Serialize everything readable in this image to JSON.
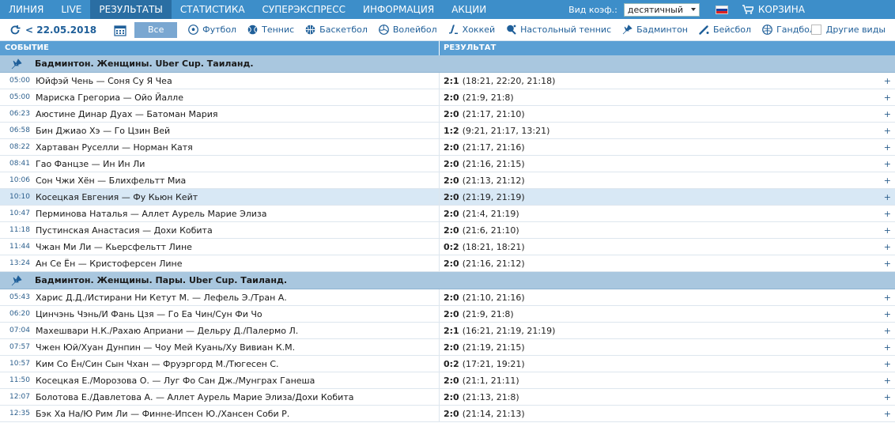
{
  "nav": {
    "items": [
      {
        "label": "ЛИНИЯ",
        "active": false
      },
      {
        "label": "LIVE",
        "active": false
      },
      {
        "label": "РЕЗУЛЬТАТЫ",
        "active": true
      },
      {
        "label": "СТАТИСТИКА",
        "active": false
      },
      {
        "label": "СУПЕРЭКСПРЕСС",
        "active": false
      },
      {
        "label": "ИНФОРМАЦИЯ",
        "active": false
      },
      {
        "label": "АКЦИИ",
        "active": false
      }
    ],
    "coef_label": "Вид коэф.:",
    "coef_value": "десятичный",
    "cart_label": "КОРЗИНА"
  },
  "filter": {
    "date": "< 22.05.2018",
    "all_label": "Все",
    "sports": [
      {
        "label": "Футбол",
        "icon": "football-icon"
      },
      {
        "label": "Теннис",
        "icon": "tennis-icon"
      },
      {
        "label": "Баскетбол",
        "icon": "basketball-icon"
      },
      {
        "label": "Волейбол",
        "icon": "volleyball-icon"
      },
      {
        "label": "Хоккей",
        "icon": "hockey-icon"
      },
      {
        "label": "Настольный теннис",
        "icon": "table-tennis-icon"
      },
      {
        "label": "Бадминтон",
        "icon": "badminton-icon"
      },
      {
        "label": "Бейсбол",
        "icon": "baseball-icon"
      },
      {
        "label": "Гандбол",
        "icon": "handball-icon"
      }
    ],
    "others_label": "Другие виды"
  },
  "table": {
    "col_event": "СОБЫТИЕ",
    "col_result": "РЕЗУЛЬТАТ"
  },
  "groups": [
    {
      "title": "Бадминтон. Женщины. Uber Cup. Таиланд.",
      "rows": [
        {
          "time": "05:00",
          "event": "Юйфэй Чень — Соня Су Я Чеа",
          "score": "2:1",
          "detail": "(18:21, 22:20, 21:18)"
        },
        {
          "time": "05:00",
          "event": "Мариска Грегориа — Ойо Йалле",
          "score": "2:0",
          "detail": "(21:9, 21:8)"
        },
        {
          "time": "06:23",
          "event": "Аюстине Динар Дуах — Батоман Мария",
          "score": "2:0",
          "detail": "(21:17, 21:10)"
        },
        {
          "time": "06:58",
          "event": "Бин Джиао Хэ — Го Цзин Вей",
          "score": "1:2",
          "detail": "(9:21, 21:17, 13:21)"
        },
        {
          "time": "08:22",
          "event": "Хартаван Руселли — Норман Катя",
          "score": "2:0",
          "detail": "(21:17, 21:16)"
        },
        {
          "time": "08:41",
          "event": "Гао Фанцзе — Ин Ин Ли",
          "score": "2:0",
          "detail": "(21:16, 21:15)"
        },
        {
          "time": "10:06",
          "event": "Сон Чжи Хён — Блихфельтт Миа",
          "score": "2:0",
          "detail": "(21:13, 21:12)"
        },
        {
          "time": "10:10",
          "event": "Косецкая Евгения — Фу Кьюн Кейт",
          "score": "2:0",
          "detail": "(21:19, 21:19)",
          "highlight": true
        },
        {
          "time": "10:47",
          "event": "Перминова Наталья — Аллет Аурель Марие Элиза",
          "score": "2:0",
          "detail": "(21:4, 21:19)"
        },
        {
          "time": "11:18",
          "event": "Пустинская Анастасия — Дохи Кобита",
          "score": "2:0",
          "detail": "(21:6, 21:10)"
        },
        {
          "time": "11:44",
          "event": "Чжан Ми Ли — Кьерсфельтт Лине",
          "score": "0:2",
          "detail": "(18:21, 18:21)"
        },
        {
          "time": "13:24",
          "event": "Ан Се Ён — Кристоферсен Лине",
          "score": "2:0",
          "detail": "(21:16, 21:12)"
        }
      ]
    },
    {
      "title": "Бадминтон. Женщины. Пары. Uber Cup. Таиланд.",
      "rows": [
        {
          "time": "05:43",
          "event": "Харис Д.Д./Истирани Ни Кетут М. — Лефель Э./Тран А.",
          "score": "2:0",
          "detail": "(21:10, 21:16)"
        },
        {
          "time": "06:20",
          "event": "Цинчэнь Чэнь/И Фань Цзя — Го Еа Чин/Сун Фи Чо",
          "score": "2:0",
          "detail": "(21:9, 21:8)"
        },
        {
          "time": "07:04",
          "event": "Махешвари Н.К./Рахаю Априани — Дельру Д./Палермо Л.",
          "score": "2:1",
          "detail": "(16:21, 21:19, 21:19)"
        },
        {
          "time": "07:57",
          "event": "Чжен Юй/Хуан Дунпин — Чоу Мей Куань/Ху Вивиан К.М.",
          "score": "2:0",
          "detail": "(21:19, 21:15)"
        },
        {
          "time": "10:57",
          "event": "Ким Со Ён/Син Сын Чхан — Фруэргорд М./Тюгесен С.",
          "score": "0:2",
          "detail": "(17:21, 19:21)"
        },
        {
          "time": "11:50",
          "event": "Косецкая Е./Морозова О. — Луг Фо Сан Дж./Мунграх Ганеша",
          "score": "2:0",
          "detail": "(21:1, 21:11)"
        },
        {
          "time": "12:07",
          "event": "Болотова Е./Давлетова А. — Аллет Аурель Марие Элиза/Дохи Кобита",
          "score": "2:0",
          "detail": "(21:13, 21:8)"
        },
        {
          "time": "12:35",
          "event": "Бэк Ха На/Ю Рим Ли — Финне-Ипсен Ю./Хансен Соби Р.",
          "score": "2:0",
          "detail": "(21:14, 21:13)"
        }
      ]
    }
  ]
}
